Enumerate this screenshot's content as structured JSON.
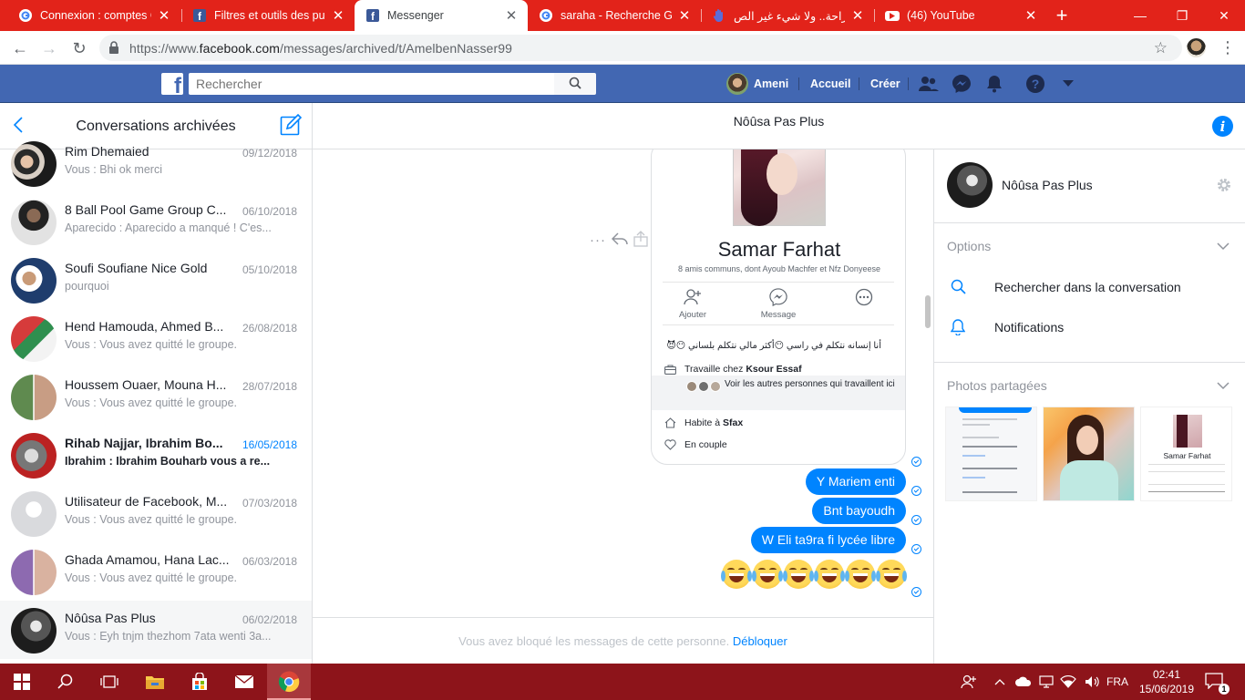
{
  "browser": {
    "tabs": [
      {
        "title": "Connexion : comptes G",
        "favicon": "google-icon",
        "active": false
      },
      {
        "title": "Filtres et outils des publ",
        "favicon": "facebook-icon",
        "active": false
      },
      {
        "title": "Messenger",
        "favicon": "facebook-icon",
        "active": true
      },
      {
        "title": "saraha - Recherche Goo",
        "favicon": "google-icon",
        "active": false
      },
      {
        "title": "الصراحة.. ولا شيء غير الص",
        "favicon": "hand-icon",
        "active": false
      },
      {
        "title": "(46) YouTube",
        "favicon": "youtube-icon",
        "active": false
      }
    ],
    "new_tab_label": "+",
    "url_prefix": "https://www.",
    "url_domain": "facebook.com",
    "url_path": "/messages/archived/t/AmelbenNasser99"
  },
  "fb": {
    "search_placeholder": "Rechercher",
    "user_name": "Ameni",
    "nav_home": "Accueil",
    "nav_create": "Créer",
    "brand_color": "#4267b2"
  },
  "left": {
    "title": "Conversations archivées",
    "conversations": [
      {
        "name": "Rim Dhemaied",
        "date": "09/12/2018",
        "snippet": "Vous : Bhi ok merci",
        "unread": false,
        "selected": false
      },
      {
        "name": "8 Ball Pool Game Group C...",
        "date": "06/10/2018",
        "snippet": "Aparecido : Aparecido a manqué ! C'es...",
        "unread": false,
        "selected": false
      },
      {
        "name": "Soufi Soufiane Nice Gold",
        "date": "05/10/2018",
        "snippet": "pourquoi",
        "unread": false,
        "selected": false
      },
      {
        "name": "Hend Hamouda, Ahmed B...",
        "date": "26/08/2018",
        "snippet": "Vous : Vous avez quitté le groupe.",
        "unread": false,
        "selected": false
      },
      {
        "name": "Houssem Ouaer, Mouna H...",
        "date": "28/07/2018",
        "snippet": "Vous : Vous avez quitté le groupe.",
        "unread": false,
        "selected": false
      },
      {
        "name": "Rihab Najjar, Ibrahim Bo...",
        "date": "16/05/2018",
        "snippet": "Ibrahim : Ibrahim Bouharb vous a re...",
        "unread": true,
        "selected": false
      },
      {
        "name": "Utilisateur de Facebook, M...",
        "date": "07/03/2018",
        "snippet": "Vous : Vous avez quitté le groupe.",
        "unread": false,
        "selected": false
      },
      {
        "name": "Ghada Amamou, Hana Lac...",
        "date": "06/03/2018",
        "snippet": "Vous : Vous avez quitté le groupe.",
        "unread": false,
        "selected": false
      },
      {
        "name": "Nôûsa Pas Plus",
        "date": "06/02/2018",
        "snippet": "Vous : Eyh tnjm thezhom 7ata wenti 3a...",
        "unread": false,
        "selected": true
      }
    ]
  },
  "conversation": {
    "title": "Nôûsa Pas Plus",
    "shared_card": {
      "name": "Samar Farhat",
      "mutual": "8 amis communs, dont Ayoub Machfer et Nfz Donyeese",
      "action_add": "Ajouter",
      "action_message": "Message",
      "bio": "أنا إنسانه نتكلم  في راسي 😶أكثر مالي نتكلم بلساني 😶😈",
      "work_prefix": "Travaille chez ",
      "work_place": "Ksour Essaf",
      "coworkers": "Voir les autres personnes qui travaillent ici",
      "lives_prefix": "Habite à ",
      "lives_city": "Sfax",
      "relationship": "En couple"
    },
    "messages": [
      {
        "text": "Y Mariem enti"
      },
      {
        "text": "Bnt bayoudh"
      },
      {
        "text": "W Eli ta9ra fi lycée libre"
      }
    ],
    "emoji_count": 6,
    "blocked_text": "Vous avez bloqué les messages de cette personne.",
    "unblock_label": "Débloquer"
  },
  "right": {
    "name": "Nôûsa Pas Plus",
    "options_label": "Options",
    "search_label": "Rechercher dans la conversation",
    "notifications_label": "Notifications",
    "photos_label": "Photos partagées",
    "thumb3_name": "Samar Farhat"
  },
  "taskbar": {
    "lang": "FRA",
    "time": "02:41",
    "date": "15/06/2019",
    "notif_count": "1",
    "accent": "#8d141a"
  }
}
